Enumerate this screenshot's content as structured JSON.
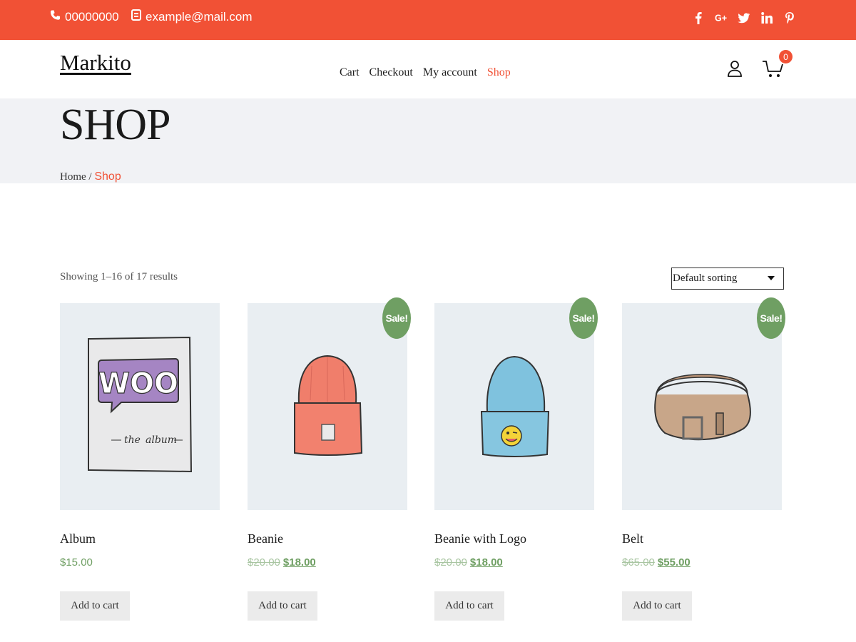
{
  "topbar": {
    "phone": "00000000",
    "email": "example@mail.com",
    "social_icons": [
      "facebook-icon",
      "google-plus-icon",
      "twitter-icon",
      "linkedin-icon",
      "pinterest-icon"
    ],
    "background": "#f15135"
  },
  "header": {
    "logo": "Markito",
    "nav": [
      {
        "label": "Cart",
        "active": false
      },
      {
        "label": "Checkout",
        "active": false
      },
      {
        "label": "My account",
        "active": false
      },
      {
        "label": "Shop",
        "active": true
      }
    ],
    "cart_count": "0"
  },
  "page": {
    "title": "SHOP",
    "breadcrumb": {
      "home": "Home",
      "separator": "/",
      "current": "Shop"
    }
  },
  "toolbar": {
    "result_count": "Showing 1–16 of 17 results",
    "sort_selected": "Default sorting"
  },
  "products": [
    {
      "name": "Album",
      "price": "$15.00",
      "old_price": "",
      "sale": false,
      "button": "Add to cart",
      "image": "album"
    },
    {
      "name": "Beanie",
      "price": "$18.00",
      "old_price": "$20.00",
      "sale": true,
      "sale_label": "Sale!",
      "button": "Add to cart",
      "image": "beanie"
    },
    {
      "name": "Beanie with Logo",
      "price": "$18.00",
      "old_price": "$20.00",
      "sale": true,
      "sale_label": "Sale!",
      "button": "Add to cart",
      "image": "beanie-logo"
    },
    {
      "name": "Belt",
      "price": "$55.00",
      "old_price": "$65.00",
      "sale": true,
      "sale_label": "Sale!",
      "button": "Add to cart",
      "image": "belt"
    }
  ],
  "colors": {
    "accent": "#f15135",
    "sale": "#6f9f63",
    "band": "#f1f2f5"
  }
}
